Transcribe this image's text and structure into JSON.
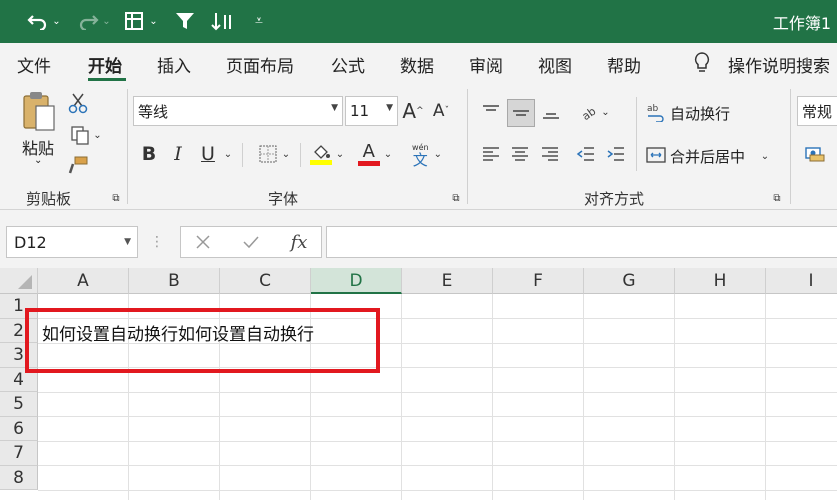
{
  "titlebar": {
    "title": "工作簿1",
    "colors": {
      "bg": "#217346"
    }
  },
  "tabs": [
    {
      "label": "文件",
      "active": false
    },
    {
      "label": "开始",
      "active": true
    },
    {
      "label": "插入",
      "active": false
    },
    {
      "label": "页面布局",
      "active": false
    },
    {
      "label": "公式",
      "active": false
    },
    {
      "label": "数据",
      "active": false
    },
    {
      "label": "审阅",
      "active": false
    },
    {
      "label": "视图",
      "active": false
    },
    {
      "label": "帮助",
      "active": false
    }
  ],
  "tell_me": "操作说明搜索",
  "ribbon": {
    "paste_label": "粘贴",
    "clipboard_label": "剪贴板",
    "font_name": "等线",
    "font_size": "11",
    "font_label": "字体",
    "wrap_text": "自动换行",
    "merge_center": "合并后居中",
    "alignment_label": "对齐方式",
    "number_format": "常规",
    "bold": "B",
    "italic": "I",
    "underline": "U"
  },
  "formula_bar": {
    "name_box": "D12",
    "fx": "fx",
    "formula": ""
  },
  "grid": {
    "columns": [
      "A",
      "B",
      "C",
      "D",
      "E",
      "F",
      "G",
      "H",
      "I"
    ],
    "selected_column": "D",
    "rows": [
      "1",
      "2",
      "3",
      "4",
      "5",
      "6",
      "7",
      "8"
    ],
    "cell_A2": "如何设置自动换行如何设置自动换行"
  },
  "colors": {
    "accent": "#217346",
    "highlight": "#e2181f"
  }
}
